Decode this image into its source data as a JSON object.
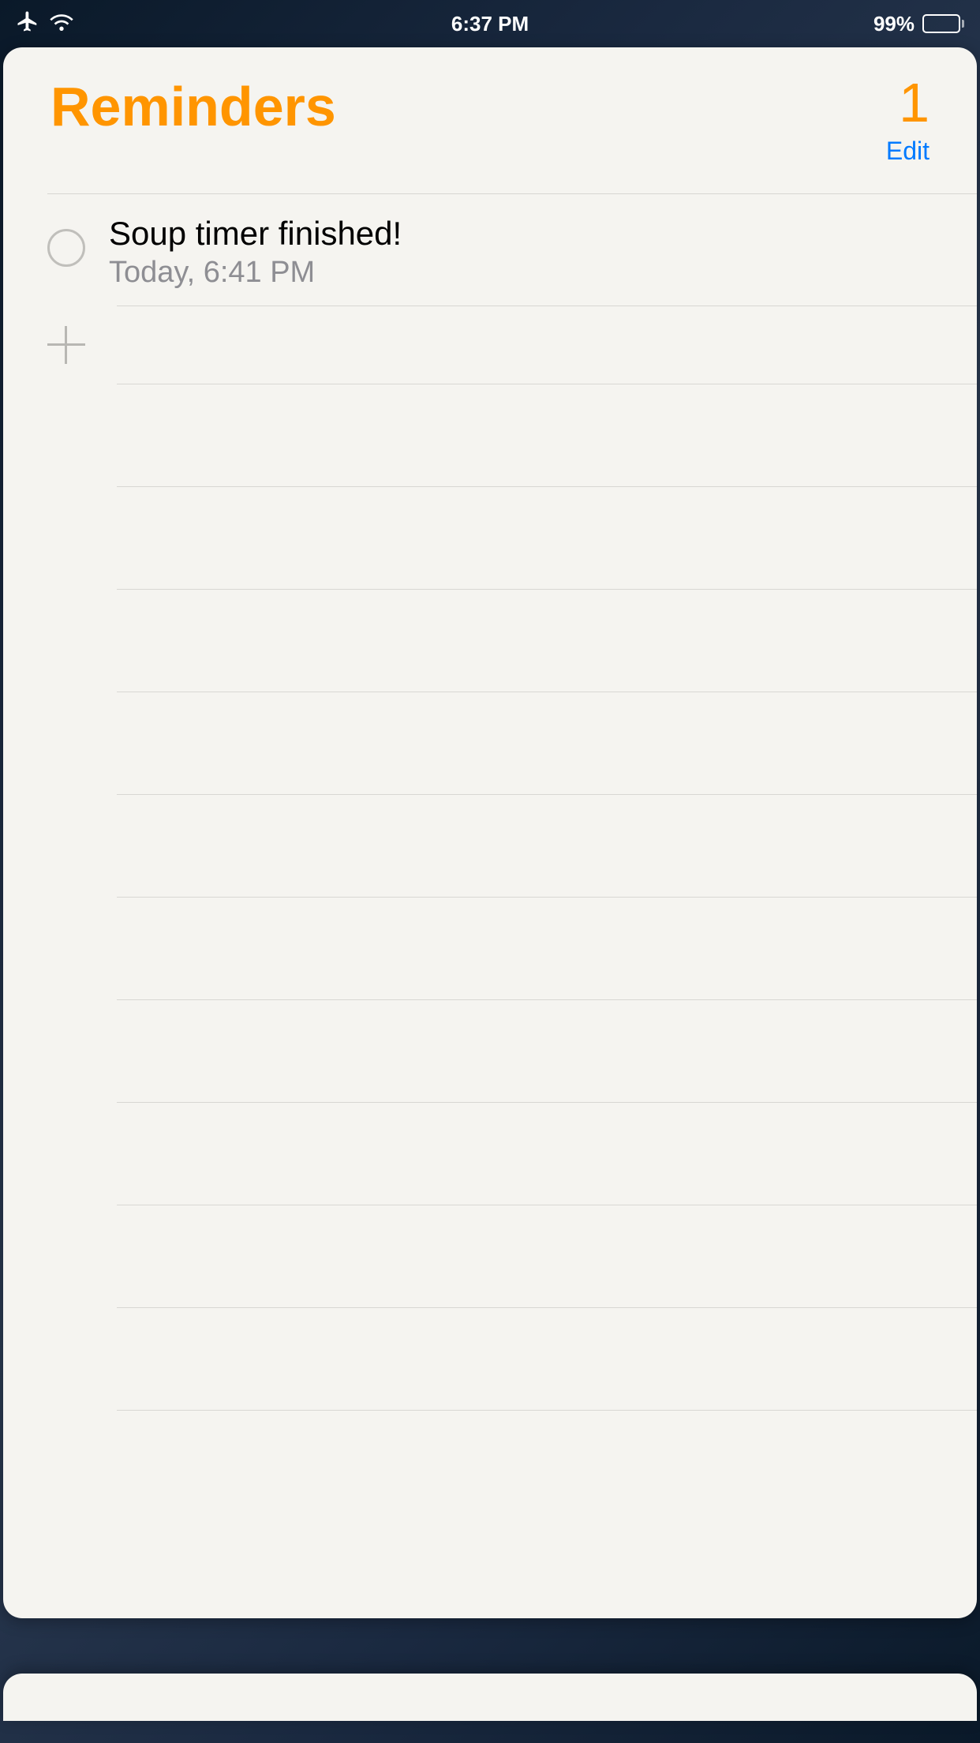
{
  "statusBar": {
    "time": "6:37 PM",
    "batteryPercent": "99%"
  },
  "header": {
    "title": "Reminders",
    "count": "1",
    "editLabel": "Edit"
  },
  "reminders": [
    {
      "title": "Soup timer finished!",
      "time": "Today, 6:41 PM"
    }
  ],
  "colors": {
    "accent": "#ff9500",
    "link": "#007aff"
  }
}
